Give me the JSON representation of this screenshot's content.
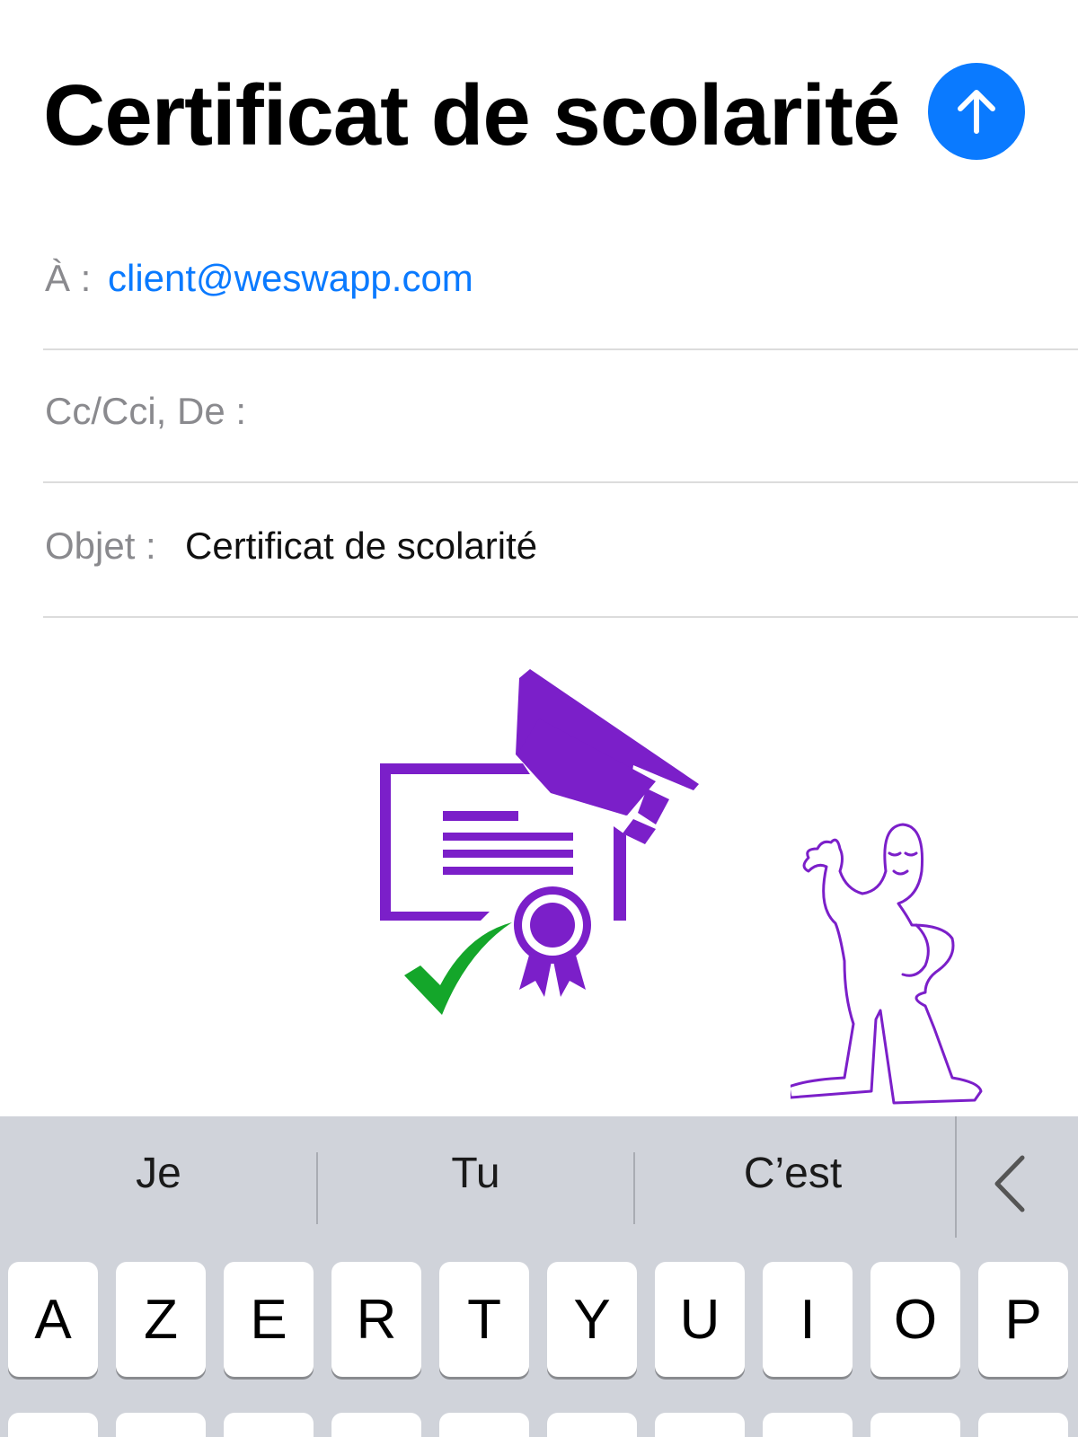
{
  "header": {
    "title": "Certificat de scolarité",
    "send_icon": "arrow-up-icon",
    "accent_color": "#0a7aff"
  },
  "fields": {
    "to_label": "À :",
    "to_value": "client@weswapp.com",
    "cc_label": "Cc/Cci, De :",
    "subject_label": "Objet :",
    "subject_value": "Certificat de scolarité"
  },
  "illustration": {
    "icons": [
      "certificate-icon",
      "graduation-cap-icon",
      "award-ribbon-icon",
      "checkmark-icon",
      "waving-person-illustration"
    ],
    "colors": {
      "purple": "#7b1fc9",
      "green": "#14a62a"
    }
  },
  "keyboard": {
    "suggestions": [
      "Je",
      "Tu",
      "C’est"
    ],
    "back_icon": "chevron-left-icon",
    "row1": [
      "A",
      "Z",
      "E",
      "R",
      "T",
      "Y",
      "U",
      "I",
      "O",
      "P"
    ]
  }
}
